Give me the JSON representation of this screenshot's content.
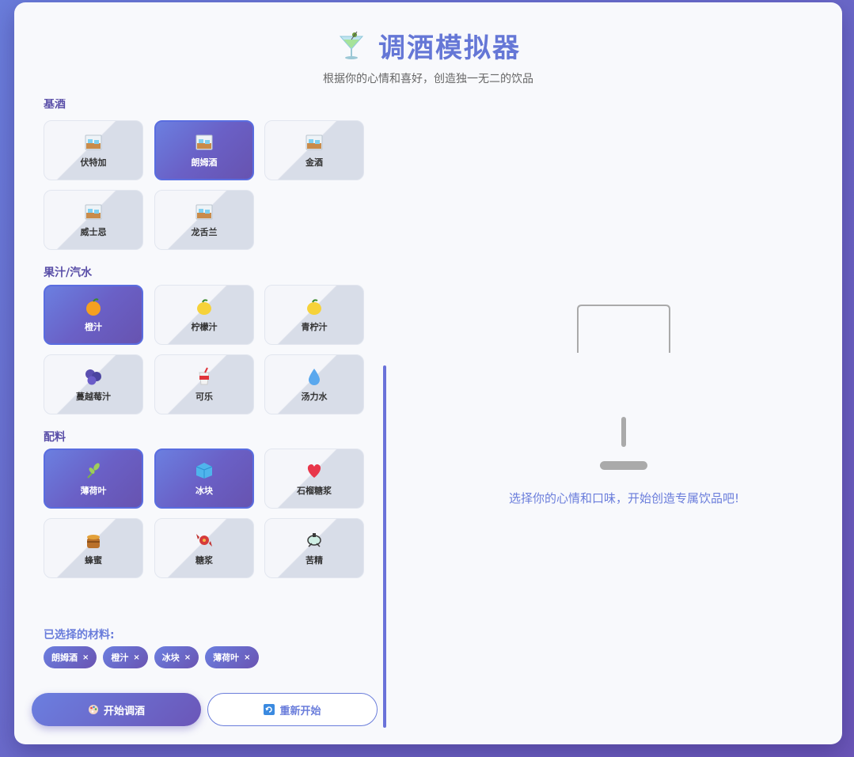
{
  "header": {
    "title": "调酒模拟器",
    "subtitle": "根据你的心情和喜好，创造独一无二的饮品",
    "title_icon": "cocktail-icon"
  },
  "categories": [
    {
      "label": "基酒",
      "items": [
        {
          "label": "伏特加",
          "icon": "whiskey-glass-icon",
          "selected": false
        },
        {
          "label": "朗姆酒",
          "icon": "whiskey-glass-icon",
          "selected": true
        },
        {
          "label": "金酒",
          "icon": "whiskey-glass-icon",
          "selected": false
        },
        {
          "label": "威士忌",
          "icon": "whiskey-glass-icon",
          "selected": false
        },
        {
          "label": "龙舌兰",
          "icon": "whiskey-glass-icon",
          "selected": false
        }
      ]
    },
    {
      "label": "果汁/汽水",
      "items": [
        {
          "label": "橙汁",
          "icon": "orange-icon",
          "selected": true
        },
        {
          "label": "柠檬汁",
          "icon": "lemon-icon",
          "selected": false
        },
        {
          "label": "青柠汁",
          "icon": "lemon-icon",
          "selected": false
        },
        {
          "label": "蔓越莓汁",
          "icon": "blueberries-icon",
          "selected": false
        },
        {
          "label": "可乐",
          "icon": "cup-with-straw-icon",
          "selected": false
        },
        {
          "label": "汤力水",
          "icon": "droplet-icon",
          "selected": false
        }
      ]
    },
    {
      "label": "配料",
      "items": [
        {
          "label": "薄荷叶",
          "icon": "herb-icon",
          "selected": true
        },
        {
          "label": "冰块",
          "icon": "ice-cube-icon",
          "selected": true
        },
        {
          "label": "石榴糖浆",
          "icon": "heart-icon",
          "selected": false
        },
        {
          "label": "蜂蜜",
          "icon": "honey-pot-icon",
          "selected": false
        },
        {
          "label": "糖浆",
          "icon": "candy-icon",
          "selected": false
        },
        {
          "label": "苦精",
          "icon": "bitters-bottle-icon",
          "selected": false
        }
      ]
    }
  ],
  "selected": {
    "label": "已选择的材料:",
    "chips": [
      "朗姆酒",
      "橙汁",
      "冰块",
      "薄荷叶"
    ],
    "remove_glyph": "×"
  },
  "buttons": {
    "start": "开始调酒",
    "reset": "重新开始",
    "start_icon": "palette-icon",
    "reset_icon": "refresh-icon"
  },
  "result": {
    "hint": "选择你的心情和口味，开始创造专属饮品吧!"
  },
  "colors": {
    "accent": "#6a7ddb",
    "accent_dark": "#6b56b8",
    "card_bg": "#f8f9fc"
  }
}
